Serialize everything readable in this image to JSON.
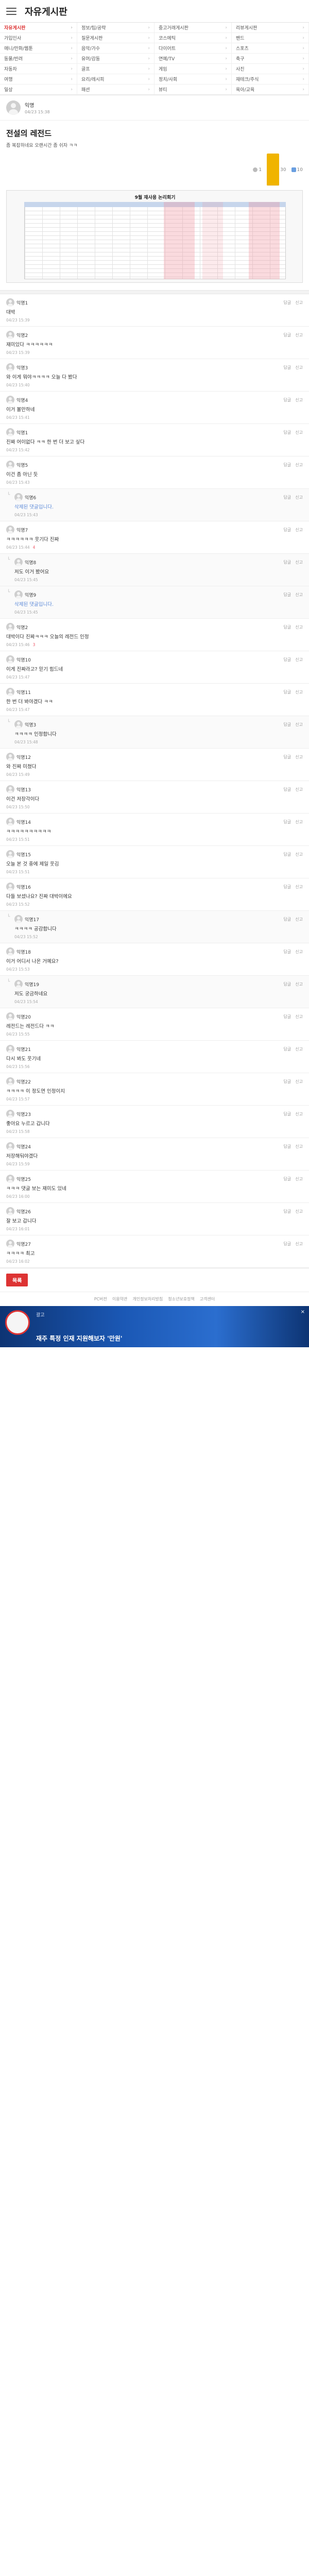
{
  "header": {
    "board_title": "자유게시판"
  },
  "categories": [
    {
      "label": "자유게시판",
      "active": true
    },
    {
      "label": "정보/팁/공략",
      "active": false
    },
    {
      "label": "중고거래게시판",
      "active": false
    },
    {
      "label": "리뷰게시판",
      "active": false
    },
    {
      "label": "가입인사",
      "active": false
    },
    {
      "label": "질문게시판",
      "active": false
    },
    {
      "label": "코스메틱",
      "active": false
    },
    {
      "label": "밴드",
      "active": false
    },
    {
      "label": "애니/만화/웹툰",
      "active": false
    },
    {
      "label": "음악/가수",
      "active": false
    },
    {
      "label": "다이어트",
      "active": false
    },
    {
      "label": "스포츠",
      "active": false
    },
    {
      "label": "동물/반려",
      "active": false
    },
    {
      "label": "유머/감동",
      "active": false
    },
    {
      "label": "연예/TV",
      "active": false
    },
    {
      "label": "축구",
      "active": false
    },
    {
      "label": "자동차",
      "active": false
    },
    {
      "label": "골프",
      "active": false
    },
    {
      "label": "게임",
      "active": false
    },
    {
      "label": "사진",
      "active": false
    },
    {
      "label": "여행",
      "active": false
    },
    {
      "label": "요리/레시피",
      "active": false
    },
    {
      "label": "정치/사회",
      "active": false
    },
    {
      "label": "재테크/주식",
      "active": false
    },
    {
      "label": "일상",
      "active": false
    },
    {
      "label": "패션",
      "active": false
    },
    {
      "label": "뷰티",
      "active": false
    },
    {
      "label": "육아/교육",
      "active": false
    }
  ],
  "post": {
    "author": "익명",
    "date": "04/23 15:38",
    "title": "전설의 레전드",
    "summary": "좀 복잡하네요 오랜시간 좀 쉬자 ㅋㅋ",
    "views": "1",
    "comments": "30",
    "likes": "10",
    "image_banner": "9월 재사용 논리회기"
  },
  "comments": [
    {
      "author": "익명1",
      "body": "대박",
      "date": "04/23 15:39",
      "likes": "",
      "reply": false
    },
    {
      "author": "익명2",
      "body": "재미있다 ㅋㅋㅋㅋㅋㅋ",
      "date": "04/23 15:39",
      "likes": "",
      "reply": false
    },
    {
      "author": "익명3",
      "body": "와 이게 뭐야ㅋㅋㅋㅋ 오늘 다 봤다",
      "date": "04/23 15:40",
      "likes": "",
      "reply": false
    },
    {
      "author": "익명4",
      "body": "이거 볼만하네",
      "date": "04/23 15:41",
      "likes": "",
      "reply": false
    },
    {
      "author": "익명1",
      "body": "진짜 어이없다 ㅋㅋ 한 번 더 보고 싶다",
      "date": "04/23 15:42",
      "likes": "",
      "reply": false
    },
    {
      "author": "익명5",
      "body": "이건 좀 아닌 듯",
      "date": "04/23 15:43",
      "likes": "",
      "reply": false
    },
    {
      "author": "익명6",
      "body": "삭제된 댓글입니다.",
      "date": "04/23 15:43",
      "likes": "",
      "reply": true,
      "deleted": true
    },
    {
      "author": "익명7",
      "body": "ㅋㅋㅋㅋㅋㅋ 웃기다 진짜",
      "date": "04/23 15:44",
      "likes": "4",
      "reply": false
    },
    {
      "author": "익명8",
      "body": "저도 이거 봤어요",
      "date": "04/23 15:45",
      "likes": "",
      "reply": true
    },
    {
      "author": "익명9",
      "body": "삭제된 댓글입니다.",
      "date": "04/23 15:45",
      "likes": "",
      "reply": true,
      "deleted": true
    },
    {
      "author": "익명2",
      "body": "대박이다 진짜ㅋㅋㅋ 오늘의 레전드 인정",
      "date": "04/23 15:46",
      "likes": "3",
      "reply": false
    },
    {
      "author": "익명10",
      "body": "이게 진짜라고? 믿기 힘드네",
      "date": "04/23 15:47",
      "likes": "",
      "reply": false
    },
    {
      "author": "익명11",
      "body": "한 번 더 봐야겠다 ㅋㅋ",
      "date": "04/23 15:47",
      "likes": "",
      "reply": false
    },
    {
      "author": "익명3",
      "body": "ㅋㅋㅋㅋ 인정합니다",
      "date": "04/23 15:48",
      "likes": "",
      "reply": true
    },
    {
      "author": "익명12",
      "body": "와 진짜 미쳤다",
      "date": "04/23 15:49",
      "likes": "",
      "reply": false
    },
    {
      "author": "익명13",
      "body": "이건 저장각이다",
      "date": "04/23 15:50",
      "likes": "",
      "reply": false
    },
    {
      "author": "익명14",
      "body": "ㅋㅋㅋㅋㅋㅋㅋㅋㅋㅋ",
      "date": "04/23 15:51",
      "likes": "",
      "reply": false
    },
    {
      "author": "익명15",
      "body": "오늘 본 것 중에 제일 웃김",
      "date": "04/23 15:51",
      "likes": "",
      "reply": false
    },
    {
      "author": "익명16",
      "body": "다들 보셨나요? 진짜 대박이에요",
      "date": "04/23 15:52",
      "likes": "",
      "reply": false
    },
    {
      "author": "익명17",
      "body": "ㅋㅋㅋㅋ 공감합니다",
      "date": "04/23 15:52",
      "likes": "",
      "reply": true
    },
    {
      "author": "익명18",
      "body": "이거 어디서 나온 거예요?",
      "date": "04/23 15:53",
      "likes": "",
      "reply": false
    },
    {
      "author": "익명19",
      "body": "저도 궁금하네요",
      "date": "04/23 15:54",
      "likes": "",
      "reply": true
    },
    {
      "author": "익명20",
      "body": "레전드는 레전드다 ㅋㅋ",
      "date": "04/23 15:55",
      "likes": "",
      "reply": false
    },
    {
      "author": "익명21",
      "body": "다시 봐도 웃기네",
      "date": "04/23 15:56",
      "likes": "",
      "reply": false
    },
    {
      "author": "익명22",
      "body": "ㅋㅋㅋㅋ 이 정도면 인정이지",
      "date": "04/23 15:57",
      "likes": "",
      "reply": false
    },
    {
      "author": "익명23",
      "body": "좋아요 누르고 갑니다",
      "date": "04/23 15:58",
      "likes": "",
      "reply": false
    },
    {
      "author": "익명24",
      "body": "저장해둬야겠다",
      "date": "04/23 15:59",
      "likes": "",
      "reply": false
    },
    {
      "author": "익명25",
      "body": "ㅋㅋㅋ 댓글 보는 재미도 있네",
      "date": "04/23 16:00",
      "likes": "",
      "reply": false
    },
    {
      "author": "익명26",
      "body": "잘 보고 갑니다",
      "date": "04/23 16:01",
      "likes": "",
      "reply": false
    },
    {
      "author": "익명27",
      "body": "ㅋㅋㅋㅋ 최고",
      "date": "04/23 16:02",
      "likes": "",
      "reply": false
    }
  ],
  "comment_actions": {
    "reply": "답글",
    "report": "신고"
  },
  "buttons": {
    "list": "목록"
  },
  "footer": {
    "links": [
      "PC버전",
      "이용약관",
      "개인정보처리방침",
      "청소년보호정책",
      "고객센터"
    ]
  },
  "ad": {
    "subtitle": "광고",
    "headline": "재주 특정 인재 지원해보자 '만원'",
    "close": "×"
  }
}
